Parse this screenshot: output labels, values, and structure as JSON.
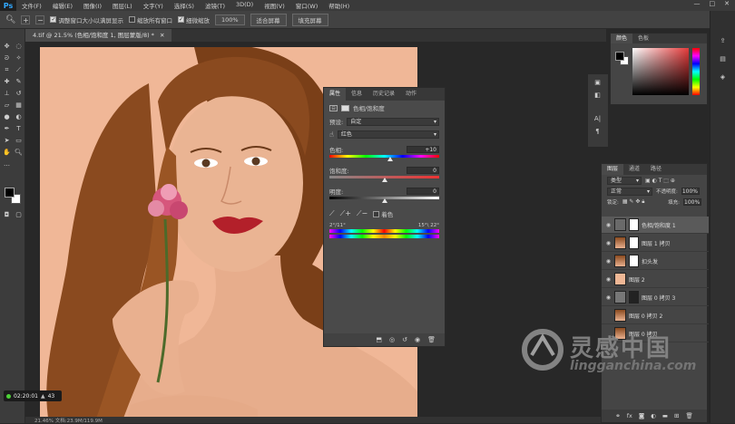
{
  "menubar": {
    "app": "Ps",
    "items": [
      "文件(F)",
      "编辑(E)",
      "图像(I)",
      "图层(L)",
      "文字(Y)",
      "选择(S)",
      "滤镜(T)",
      "3D(D)",
      "视图(V)",
      "窗口(W)",
      "帮助(H)"
    ],
    "min": "—",
    "max": "□",
    "close": "✕"
  },
  "options": {
    "check1": "调整窗口大小以满屏显示",
    "check2": "缩放所有窗口",
    "check3": "细微缩放",
    "zoom": "100%",
    "fit": "适合屏幕",
    "fill": "填充屏幕"
  },
  "doc_tab": {
    "title": "4.tif @ 21.5% (色相/饱和度 1, 图层蒙版/8) *",
    "close": "✕"
  },
  "timer": {
    "time": "02:20:01",
    "count": "43"
  },
  "status": {
    "text": "21.46%  文档:23.9M/119.9M"
  },
  "props": {
    "tabs": [
      "属性",
      "信息",
      "历史记录",
      "动作"
    ],
    "adj_title": "色相/饱和度",
    "preset_label": "预设:",
    "preset_value": "自定",
    "channel_value": "红色",
    "hue_label": "色相:",
    "hue_value": "+10",
    "sat_label": "饱和度:",
    "sat_value": "0",
    "light_label": "明度:",
    "light_value": "0",
    "colorize": "着色",
    "range_left": "2°/11°",
    "range_right": "15°\\ 22°",
    "hue_pos": 0.55,
    "sat_pos": 0.5,
    "light_pos": 0.5
  },
  "color_panel": {
    "tabs": [
      "颜色",
      "色板"
    ],
    "fg": "#000000",
    "bg": "#ffffff",
    "picker_hue": "#e53b3b"
  },
  "layers": {
    "tabs": [
      "图层",
      "通道",
      "路径"
    ],
    "filter": "类型",
    "blend": "正常",
    "opacity_label": "不透明度:",
    "opacity": "100%",
    "lock_label": "锁定:",
    "fill_label": "填充:",
    "fill": "100%",
    "rows": [
      {
        "name": "色相/饱和度 1",
        "type": "adj",
        "sel": true
      },
      {
        "name": "图层 1 拷贝",
        "type": "mask"
      },
      {
        "name": "扣头发",
        "type": "mask"
      },
      {
        "name": "图层 2",
        "type": "fill"
      },
      {
        "name": "图层 0 拷贝 3",
        "type": "grey"
      },
      {
        "name": "图层 0 拷贝 2",
        "type": "photo"
      },
      {
        "name": "图层 0 拷贝",
        "type": "photo"
      }
    ]
  },
  "watermark": {
    "cn": "灵感中国",
    "en": "lingganchina.com"
  },
  "colors": {
    "skin": "#f0b797",
    "hair": "#8a4a1f",
    "lips": "#b3202a",
    "flower": "#d6567c"
  }
}
